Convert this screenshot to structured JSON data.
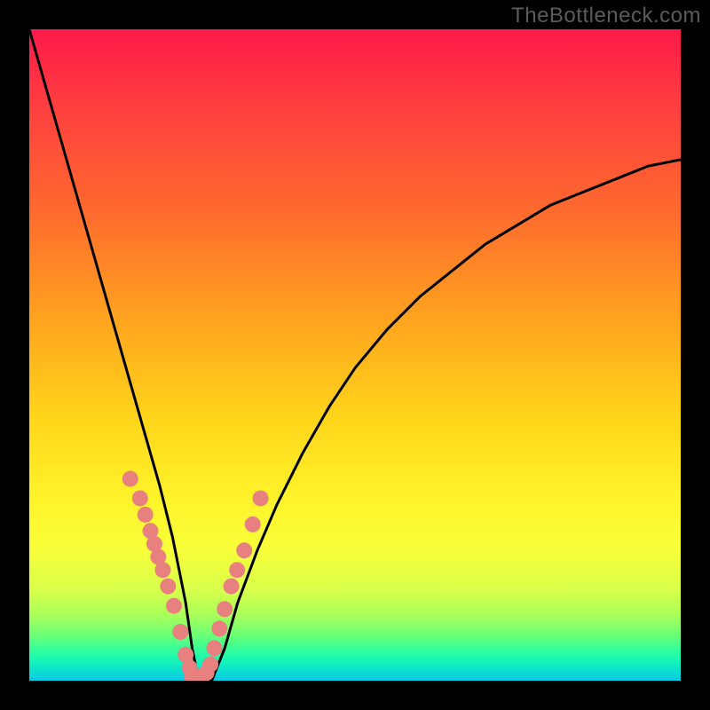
{
  "watermark": {
    "text": "TheBottleneck.com"
  },
  "chart_data": {
    "type": "line",
    "title": "",
    "xlabel": "",
    "ylabel": "",
    "xlim": [
      0,
      100
    ],
    "ylim": [
      0,
      100
    ],
    "series": [
      {
        "name": "bottleneck-curve",
        "x": [
          0,
          2,
          4,
          6,
          8,
          10,
          12,
          14,
          16,
          18,
          20,
          22,
          24,
          25,
          26,
          27,
          28,
          30,
          32,
          35,
          38,
          42,
          46,
          50,
          55,
          60,
          65,
          70,
          75,
          80,
          85,
          90,
          95,
          100
        ],
        "y": [
          100,
          93,
          86,
          79,
          72,
          65,
          58,
          51,
          44,
          37,
          30,
          22,
          12,
          5,
          0,
          0,
          0,
          5,
          12,
          20,
          27,
          35,
          42,
          48,
          54,
          59,
          63,
          67,
          70,
          73,
          75,
          77,
          79,
          80
        ]
      }
    ],
    "markers": {
      "left_branch": {
        "x": [
          15.5,
          17.0,
          17.8,
          18.6,
          19.2,
          19.8,
          20.5,
          21.3,
          22.2,
          23.2,
          24.0,
          24.6
        ],
        "y": [
          31,
          28,
          25.5,
          23,
          21,
          19,
          17,
          14.5,
          11.5,
          7.5,
          4,
          2
        ]
      },
      "right_branch": {
        "x": [
          27.8,
          28.4,
          29.2,
          30.0,
          31.0,
          31.9,
          33.0,
          34.3,
          35.5
        ],
        "y": [
          2.5,
          5,
          8,
          11,
          14.5,
          17,
          20,
          24,
          28
        ]
      },
      "bottom": {
        "x": [
          25.0,
          25.8,
          26.6,
          27.2
        ],
        "y": [
          0.5,
          0.5,
          0.8,
          1.2
        ]
      }
    },
    "colors": {
      "curve": "#000000",
      "marker_fill": "#e98080",
      "marker_stroke": "#b04a4a"
    }
  }
}
